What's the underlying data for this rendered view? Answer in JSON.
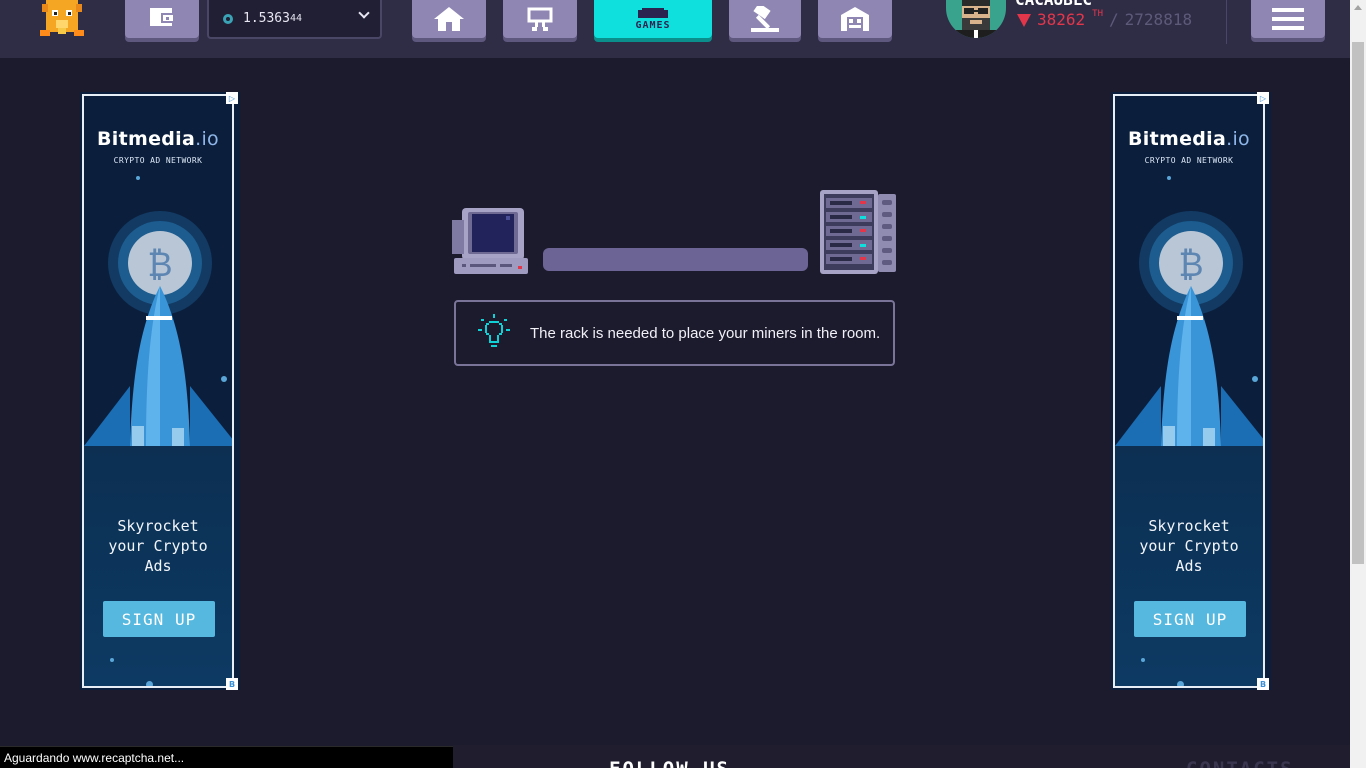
{
  "header": {
    "balance": {
      "main": "1.5363",
      "small": "44"
    },
    "games_label": "GAMES",
    "username": "CACAUBLC",
    "power": {
      "value": "38262",
      "unit": "TH",
      "separator": "/",
      "total": "2728818"
    }
  },
  "main": {
    "tip": "The rack is needed to place your miners in the room."
  },
  "ads": {
    "brand": "Bitmedia",
    "brand_suffix": ".io",
    "network": "CRYPTO AD NETWORK",
    "slogan_line1": "Skyrocket",
    "slogan_line2": "your Crypto",
    "slogan_line3": "Ads",
    "cta": "SIGN UP",
    "corner_top": "▷",
    "corner_bottom": "B"
  },
  "footer": {
    "follow": "FOLLOW US",
    "contacts": "CONTACTS"
  },
  "status_bar": "Aguardando www.recaptcha.net...",
  "colors": {
    "background": "#1c1b2d",
    "header": "#2f2d46",
    "nav_button": "#8f86b3",
    "games_active": "#0fe0dd",
    "power_down": "#e3364a",
    "progress": "#6c6495"
  },
  "icons": [
    "fox-logo-icon",
    "wallet-icon",
    "coin-icon",
    "home-icon",
    "market-icon",
    "gamepad-icon",
    "hammer-icon",
    "storage-icon",
    "menu-icon",
    "computer-icon",
    "server-rack-icon",
    "lightbulb-icon"
  ]
}
